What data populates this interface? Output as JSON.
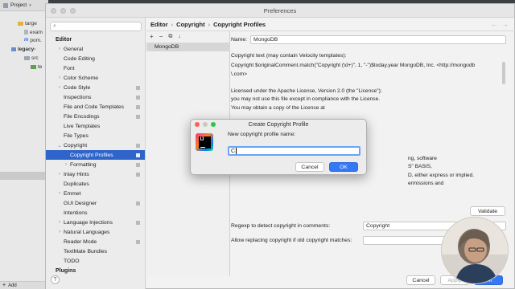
{
  "ide": {
    "project_label": "Project",
    "tree": [
      {
        "label": "targe",
        "icon": "folder-icon"
      },
      {
        "label": "exam",
        "icon": "file-icon"
      },
      {
        "label": "pom.",
        "icon": "maven-icon"
      },
      {
        "label": "legacy-",
        "icon": "module-icon"
      },
      {
        "label": "src",
        "icon": "folder-icon"
      },
      {
        "label": "te",
        "icon": "folder-icon"
      }
    ],
    "bottom_label": "Add"
  },
  "window": {
    "title": "Preferences"
  },
  "sidebar": {
    "search_placeholder": "",
    "section_editor": "Editor",
    "items": [
      {
        "label": "General",
        "arrow": "›",
        "sq": false
      },
      {
        "label": "Code Editing",
        "arrow": "",
        "sq": false
      },
      {
        "label": "Font",
        "arrow": "",
        "sq": false
      },
      {
        "label": "Color Scheme",
        "arrow": "›",
        "sq": false
      },
      {
        "label": "Code Style",
        "arrow": "›",
        "sq": true
      },
      {
        "label": "Inspections",
        "arrow": "",
        "sq": true
      },
      {
        "label": "File and Code Templates",
        "arrow": "",
        "sq": true
      },
      {
        "label": "File Encodings",
        "arrow": "",
        "sq": true
      },
      {
        "label": "Live Templates",
        "arrow": "",
        "sq": false
      },
      {
        "label": "File Types",
        "arrow": "",
        "sq": false
      },
      {
        "label": "Copyright",
        "arrow": "⌄",
        "sq": true
      },
      {
        "label": "Copyright Profiles",
        "arrow": "",
        "sq": true,
        "selected": true,
        "indent": true
      },
      {
        "label": "Formatting",
        "arrow": "›",
        "sq": true,
        "indent": true
      },
      {
        "label": "Inlay Hints",
        "arrow": "›",
        "sq": true
      },
      {
        "label": "Duplicates",
        "arrow": "",
        "sq": false
      },
      {
        "label": "Emmet",
        "arrow": "›",
        "sq": false
      },
      {
        "label": "GUI Designer",
        "arrow": "",
        "sq": true
      },
      {
        "label": "Intentions",
        "arrow": "",
        "sq": false
      },
      {
        "label": "Language Injections",
        "arrow": "›",
        "sq": true
      },
      {
        "label": "Natural Languages",
        "arrow": "›",
        "sq": false
      },
      {
        "label": "Reader Mode",
        "arrow": "",
        "sq": true
      },
      {
        "label": "TextMate Bundles",
        "arrow": "",
        "sq": false
      },
      {
        "label": "TODO",
        "arrow": "",
        "sq": false
      }
    ],
    "section_plugins": "Plugins",
    "help": "?"
  },
  "breadcrumb": {
    "items": [
      "Editor",
      "Copyright",
      "Copyright Profiles"
    ],
    "separator": "›"
  },
  "profiles": {
    "toolbar": [
      "+",
      "−",
      "⧉",
      "↓"
    ],
    "items": [
      "MongoDB"
    ]
  },
  "form": {
    "name_label": "Name:",
    "name_value": "MongoDB",
    "copyright_text_label": "Copyright text (may contain Velocity templates):",
    "copyright_lines": [
      "Copyright $originalComment.match(\"Copyright (\\d+)\", 1, \"-\")$today.year MongoDB, Inc. <http://mongodb",
      "\\.com>",
      "",
      "Licensed under the Apache License, Version 2.0 (the \"License\");",
      "you may not use this file except in compliance with the License.",
      "You may obtain a copy of the License at",
      "",
      "",
      "",
      "",
      "",
      "ng, software",
      "S\" BASIS,",
      "D, either express or implied.",
      "ermissions and"
    ],
    "validate_label": "Validate",
    "regexp_label": "Regexp to detect copyright in comments:",
    "regexp_value": "Copyright",
    "allow_replace_label": "Allow replacing copyright if old copyright matches:",
    "allow_replace_value": ""
  },
  "footer": {
    "cancel": "Cancel",
    "apply": "Apply",
    "ok": "OK"
  },
  "dialog": {
    "title": "Create Copyright Profile",
    "logo_text": "IJ",
    "prompt": "New copyright profile name:",
    "input_value": "C",
    "cancel": "Cancel",
    "ok": "OK"
  },
  "colors": {
    "selection": "#2f65ca",
    "primary_button": "#3478f6",
    "input_focus": "#6aa4f4"
  }
}
